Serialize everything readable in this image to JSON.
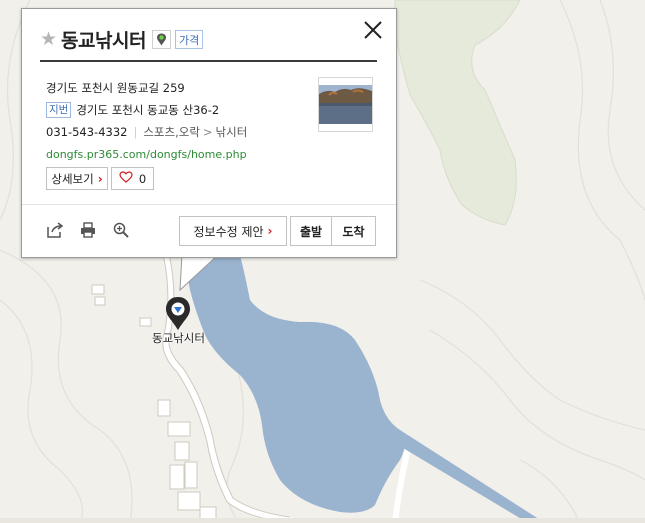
{
  "place": {
    "name": "동교낚시터",
    "price_label": "가격",
    "address_road": "경기도 포천시 원동교길 259",
    "jibeon_label": "지번",
    "address_jibeon": "경기도 포천시 동교동 산36-2",
    "phone": "031-543-4332",
    "category": "스포츠,오락",
    "subcategory": "낚시터",
    "homepage": "dongfs.pr365.com/dongfs/home.php"
  },
  "actions": {
    "detail_label": "상세보기",
    "like_count": "0",
    "suggest_edit_label": "정보수정 제안",
    "depart_label": "출발",
    "arrive_label": "도착"
  },
  "map": {
    "marker_label": "동교낚시터",
    "water_color": "#9ab3cf",
    "land_color": "#f2f0ea"
  },
  "icons": {
    "favorite": "star-icon",
    "close": "close-icon",
    "share": "share-icon",
    "print": "print-icon",
    "zoom": "zoom-icon",
    "marker": "map-pin-icon"
  }
}
